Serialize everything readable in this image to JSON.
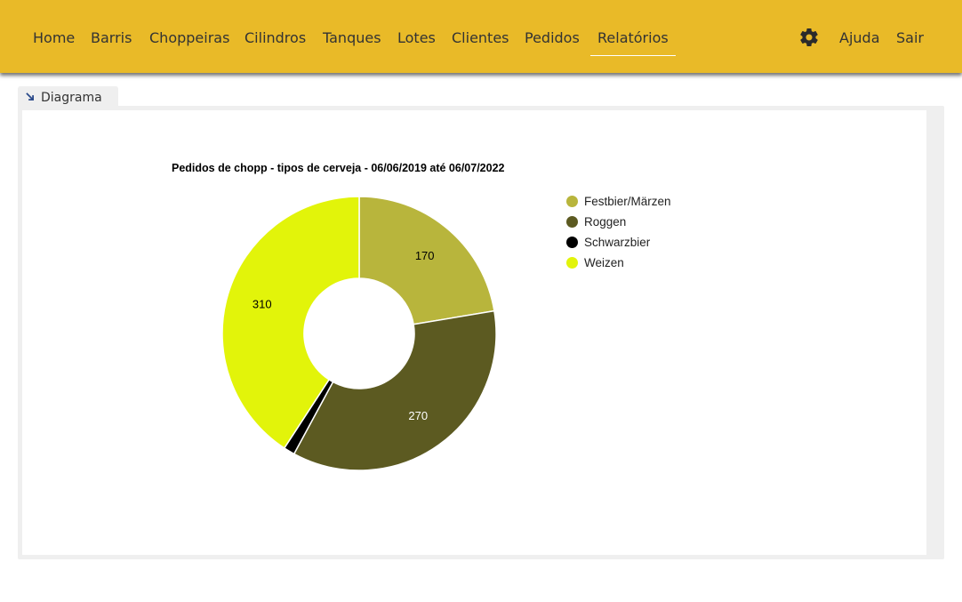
{
  "nav": {
    "items": [
      {
        "label": "Home"
      },
      {
        "label": "Barris"
      },
      {
        "label": "Choppeiras"
      },
      {
        "label": "Cilindros"
      },
      {
        "label": "Tanques"
      },
      {
        "label": "Lotes"
      },
      {
        "label": "Clientes"
      },
      {
        "label": "Pedidos"
      },
      {
        "label": "Relatórios",
        "active": true
      }
    ],
    "settings_icon": "gear-icon",
    "help_label": "Ajuda",
    "logout_label": "Sair"
  },
  "panel": {
    "tab_label": "Diagrama",
    "tab_icon": "collapse-arrow-icon"
  },
  "colors": {
    "navbar": "#e9ba28",
    "Festbier/Märzen": "#b8b53c",
    "Roggen": "#5c5a21",
    "Schwarzbier": "#000000",
    "Weizen": "#e2f40a"
  },
  "chart_data": {
    "type": "pie",
    "variant": "donut",
    "title": "Pedidos de chopp - tipos de cerveja - 06/06/2019 até 06/07/2022",
    "legend_position": "right",
    "categories": [
      "Festbier/Märzen",
      "Roggen",
      "Schwarzbier",
      "Weizen"
    ],
    "values": [
      170,
      270,
      10,
      310
    ],
    "labels": [
      "170",
      "270",
      "",
      "310"
    ]
  }
}
